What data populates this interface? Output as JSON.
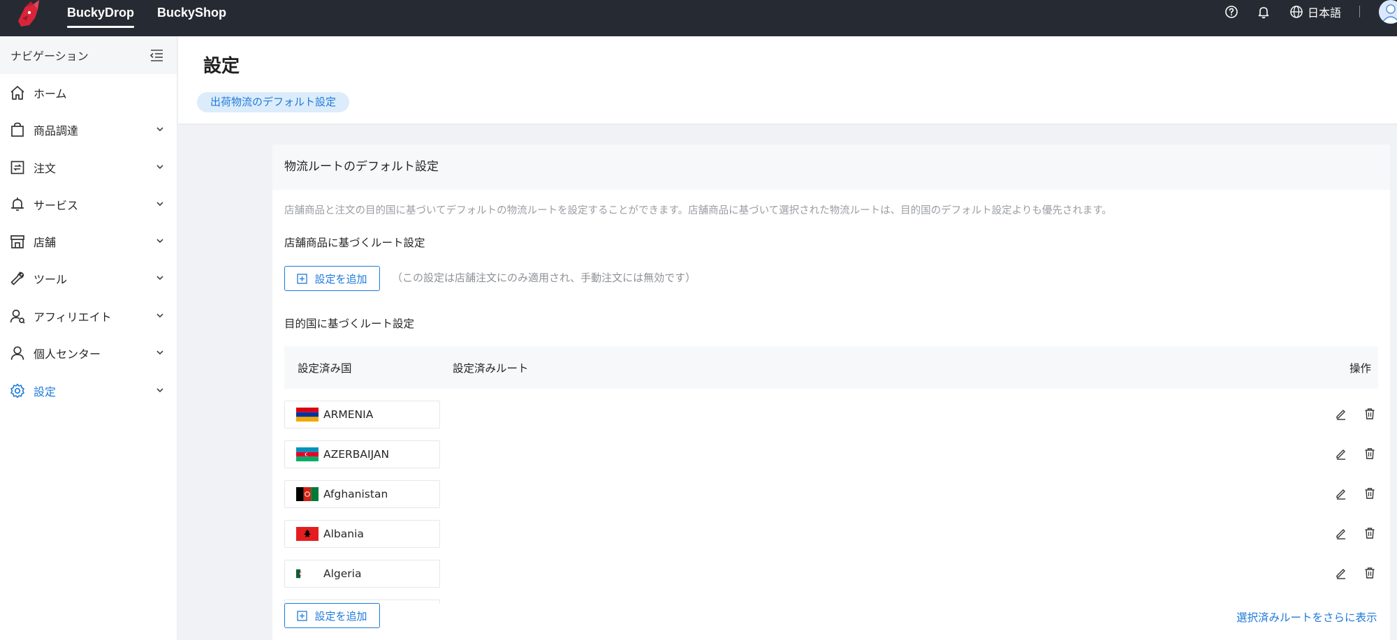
{
  "topbar": {
    "tabs": [
      {
        "label": "BuckyDrop",
        "active": true
      },
      {
        "label": "BuckyShop",
        "active": false
      }
    ],
    "language": "日本語",
    "icons": [
      "help-icon",
      "bell-icon",
      "globe-icon"
    ],
    "colors": {
      "background": "#262b33",
      "logo": "#d8253a"
    }
  },
  "sidebar": {
    "title": "ナビゲーション",
    "items": [
      {
        "label": "ホーム",
        "icon": "home-icon",
        "has_children": false,
        "active": false
      },
      {
        "label": "商品調達",
        "icon": "shopping-bag-icon",
        "has_children": true,
        "active": false
      },
      {
        "label": "注文",
        "icon": "order-icon",
        "has_children": true,
        "active": false
      },
      {
        "label": "サービス",
        "icon": "bell-service-icon",
        "has_children": true,
        "active": false
      },
      {
        "label": "店舗",
        "icon": "store-icon",
        "has_children": true,
        "active": false
      },
      {
        "label": "ツール",
        "icon": "wrench-icon",
        "has_children": true,
        "active": false
      },
      {
        "label": "アフィリエイト",
        "icon": "affiliate-icon",
        "has_children": true,
        "active": false
      },
      {
        "label": "個人センター",
        "icon": "user-icon",
        "has_children": true,
        "active": false
      },
      {
        "label": "設定",
        "icon": "gear-icon",
        "has_children": true,
        "active": true
      }
    ]
  },
  "header": {
    "title": "設定",
    "tab": "出荷物流のデフォルト設定"
  },
  "card": {
    "title": "物流ルートのデフォルト設定",
    "description": "店舗商品と注文の目的国に基づいてデフォルトの物流ルートを設定することができます。店舗商品に基づいて選択された物流ルートは、目的国のデフォルト設定よりも優先されます。",
    "product_section_title": "店舗商品に基づくルート設定",
    "add_button_label": "設定を追加",
    "product_note": "（この設定は店舗注文にのみ適用され、手動注文には無効です）",
    "country_section_title": "目的国に基づくルート設定",
    "table": {
      "columns": [
        "設定済み国",
        "設定済みルート",
        "操作"
      ],
      "rows": [
        {
          "country": "ARMENIA",
          "flag": "armenia",
          "route": ""
        },
        {
          "country": "AZERBAIJAN",
          "flag": "azerbaijan",
          "route": ""
        },
        {
          "country": "Afghanistan",
          "flag": "afghanistan",
          "route": ""
        },
        {
          "country": "Albania",
          "flag": "albania",
          "route": ""
        },
        {
          "country": "Algeria",
          "flag": "algeria",
          "route": ""
        }
      ]
    },
    "add_country_button_label": "設定を追加",
    "show_more_label": "選択済みルートをさらに表示"
  },
  "colors": {
    "primary": "#1e7ad9",
    "page_bg": "#f0f2f5",
    "tag_bg": "#dcecfb"
  }
}
